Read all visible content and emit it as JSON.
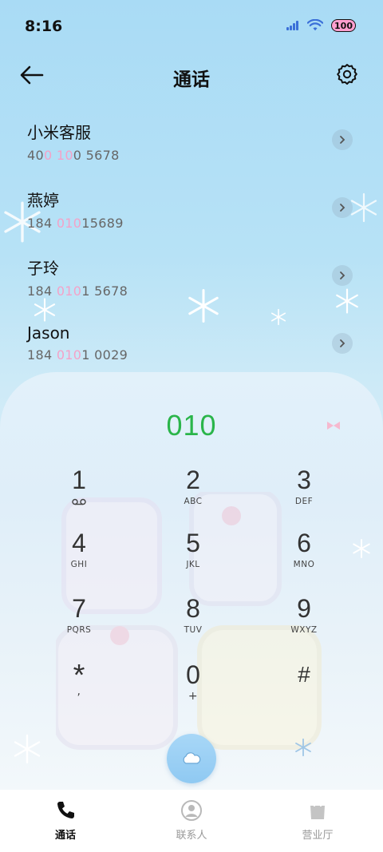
{
  "status_bar": {
    "time": "8:16",
    "battery": "100"
  },
  "header": {
    "title": "通话"
  },
  "contacts": [
    {
      "name": "小米客服",
      "number_parts": [
        "40",
        "0 10",
        "0 5678"
      ]
    },
    {
      "name": "燕婷",
      "number_parts": [
        "184 ",
        "010",
        "15689"
      ]
    },
    {
      "name": "子玲",
      "number_parts": [
        "184 ",
        "010",
        "1 5678"
      ]
    },
    {
      "name": "Jason",
      "number_parts": [
        "184 ",
        "010",
        "1 0029"
      ]
    }
  ],
  "dialer": {
    "number": "010",
    "keys": [
      {
        "digit": "1",
        "letters": ""
      },
      {
        "digit": "2",
        "letters": "ABC"
      },
      {
        "digit": "3",
        "letters": "DEF"
      },
      {
        "digit": "4",
        "letters": "GHI"
      },
      {
        "digit": "5",
        "letters": "JKL"
      },
      {
        "digit": "6",
        "letters": "MNO"
      },
      {
        "digit": "7",
        "letters": "PQRS"
      },
      {
        "digit": "8",
        "letters": "TUV"
      },
      {
        "digit": "9",
        "letters": "WXYZ"
      },
      {
        "digit": "*",
        "letters": ","
      },
      {
        "digit": "0",
        "letters": "+"
      },
      {
        "digit": "#",
        "letters": ""
      }
    ]
  },
  "bottom_nav": {
    "items": [
      {
        "label": "通话",
        "icon": "phone-icon",
        "active": true
      },
      {
        "label": "联系人",
        "icon": "person-icon",
        "active": false
      },
      {
        "label": "营业厅",
        "icon": "shopping-bag-icon",
        "active": false
      }
    ]
  },
  "colors": {
    "dialed_number": "#2ab54a",
    "number_highlight": "#f4a2c8",
    "call_button": "#9acff4"
  }
}
